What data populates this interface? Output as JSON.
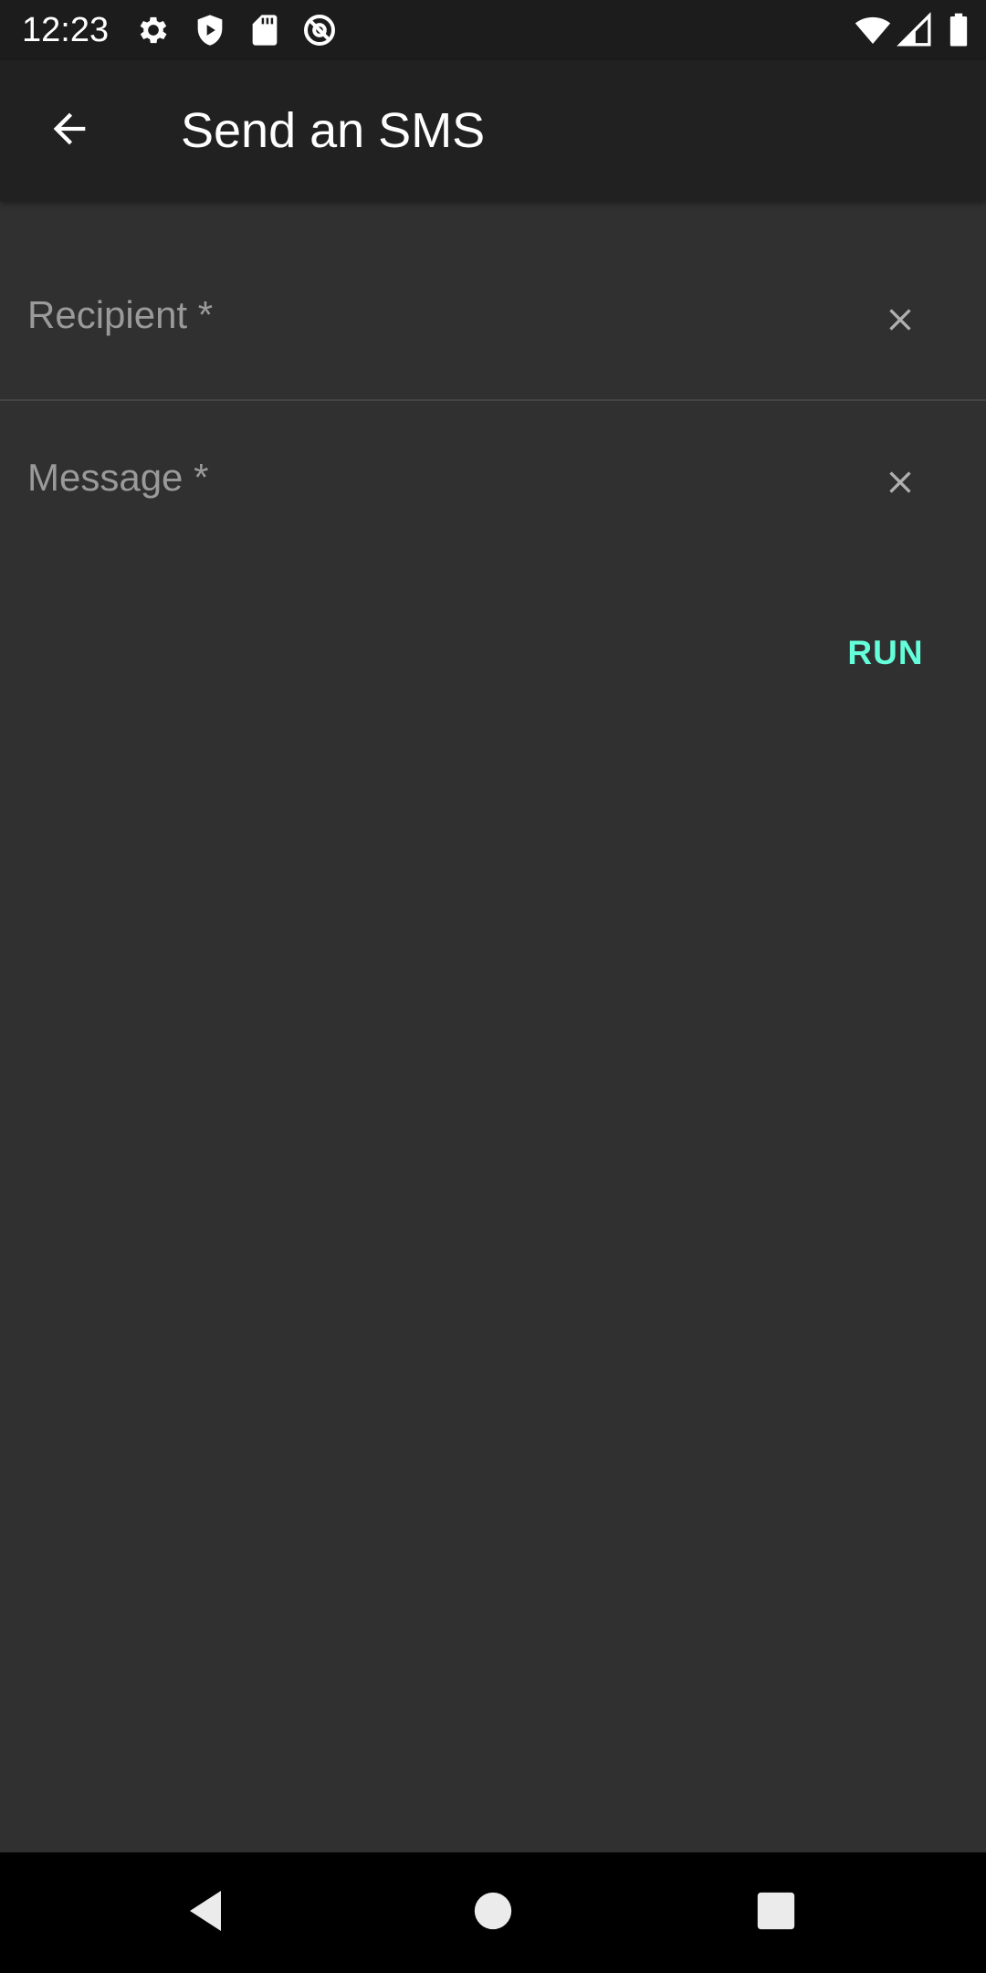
{
  "status_bar": {
    "time": "12:23",
    "icons": [
      "gear-icon",
      "shield-icon",
      "sd-card-icon",
      "at-sign-icon",
      "wifi-icon",
      "cellular-signal-icon",
      "battery-icon"
    ]
  },
  "app_bar": {
    "title": "Send an SMS",
    "back_icon": "arrow-back-icon"
  },
  "form": {
    "recipient": {
      "placeholder": "Recipient *",
      "value": "",
      "clear_icon": "close-icon"
    },
    "message": {
      "placeholder": "Message *",
      "value": "",
      "clear_icon": "close-icon"
    },
    "run_label": "RUN"
  },
  "nav_bar": {
    "icons": [
      "back-triangle-icon",
      "home-circle-icon",
      "recents-square-icon"
    ]
  },
  "colors": {
    "background": "#303030",
    "app_bar": "#212121",
    "status_bar": "#1c1c1c",
    "accent": "#64ffda",
    "placeholder": "#9a9a9a"
  }
}
